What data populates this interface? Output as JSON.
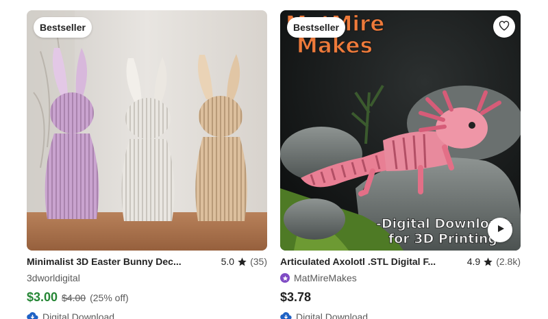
{
  "colors": {
    "sale_price": "#258635",
    "star_seller": "#7f4bc4",
    "download_icon": "#1f62c5"
  },
  "listings": [
    {
      "badge": "Bestseller",
      "title": "Minimalist 3D Easter Bunny Dec...",
      "rating": "5.0",
      "review_count": "(35)",
      "seller": "3dworldigital",
      "price": "$3.00",
      "original_price": "$4.00",
      "discount": "(25% off)",
      "delivery": "Digital Download",
      "image_text": []
    },
    {
      "badge": "Bestseller",
      "title": "Articulated Axolotl .STL Digital F...",
      "rating": "4.9",
      "review_count": "(2.8k)",
      "seller": "MatMireMakes",
      "price": "$3.78",
      "delivery": "Digital Download",
      "image_text": [
        "MatMire",
        "Makes",
        "-Digital Download-",
        "for 3D Printing"
      ]
    }
  ]
}
